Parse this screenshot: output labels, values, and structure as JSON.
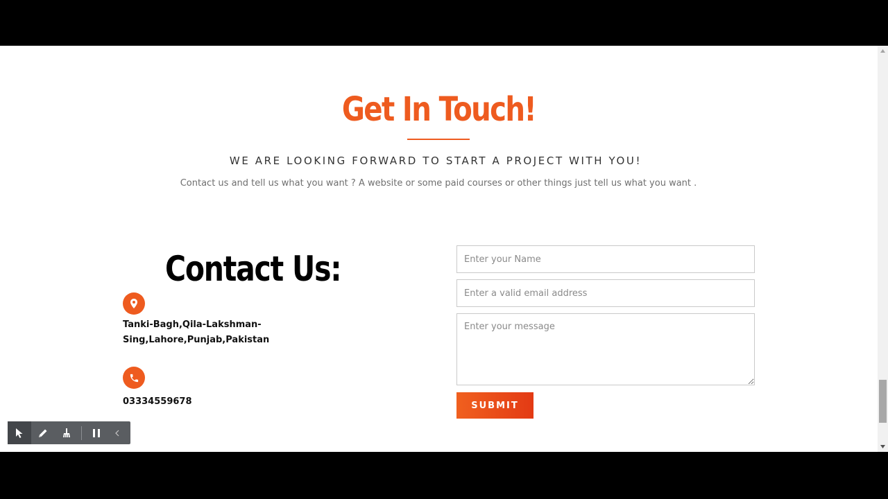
{
  "hero": {
    "title": "Get In Touch!",
    "subtitle": "WE ARE LOOKING FORWARD TO START A PROJECT WITH YOU!",
    "description": "Contact us and tell us what you want ? A website or some paid courses or other things just tell us what you want ."
  },
  "contact": {
    "heading": "Contact Us:",
    "address_line1": "Tanki-Bagh,Qila-Lakshman-",
    "address_line2": "Sing,Lahore,Punjab,Pakistan",
    "phone": "03334559678",
    "location_icon": "map-pin-icon",
    "phone_icon": "phone-icon"
  },
  "form": {
    "name_placeholder": "Enter your Name",
    "email_placeholder": "Enter a valid email address",
    "message_placeholder": "Enter your message",
    "name_value": "",
    "email_value": "",
    "message_value": "",
    "submit_label": "SUBMIT"
  },
  "toolbar": {
    "tools": [
      "select-cursor-icon",
      "pen-icon",
      "broom-icon"
    ],
    "pause_icon": "pause-icon",
    "collapse_icon": "chevron-left-icon"
  },
  "colors": {
    "accent": "#ee5b1f",
    "submit_gradient_start": "#f0601f",
    "submit_gradient_end": "#e33a14",
    "toolbar_bg": "#5a5d61"
  }
}
